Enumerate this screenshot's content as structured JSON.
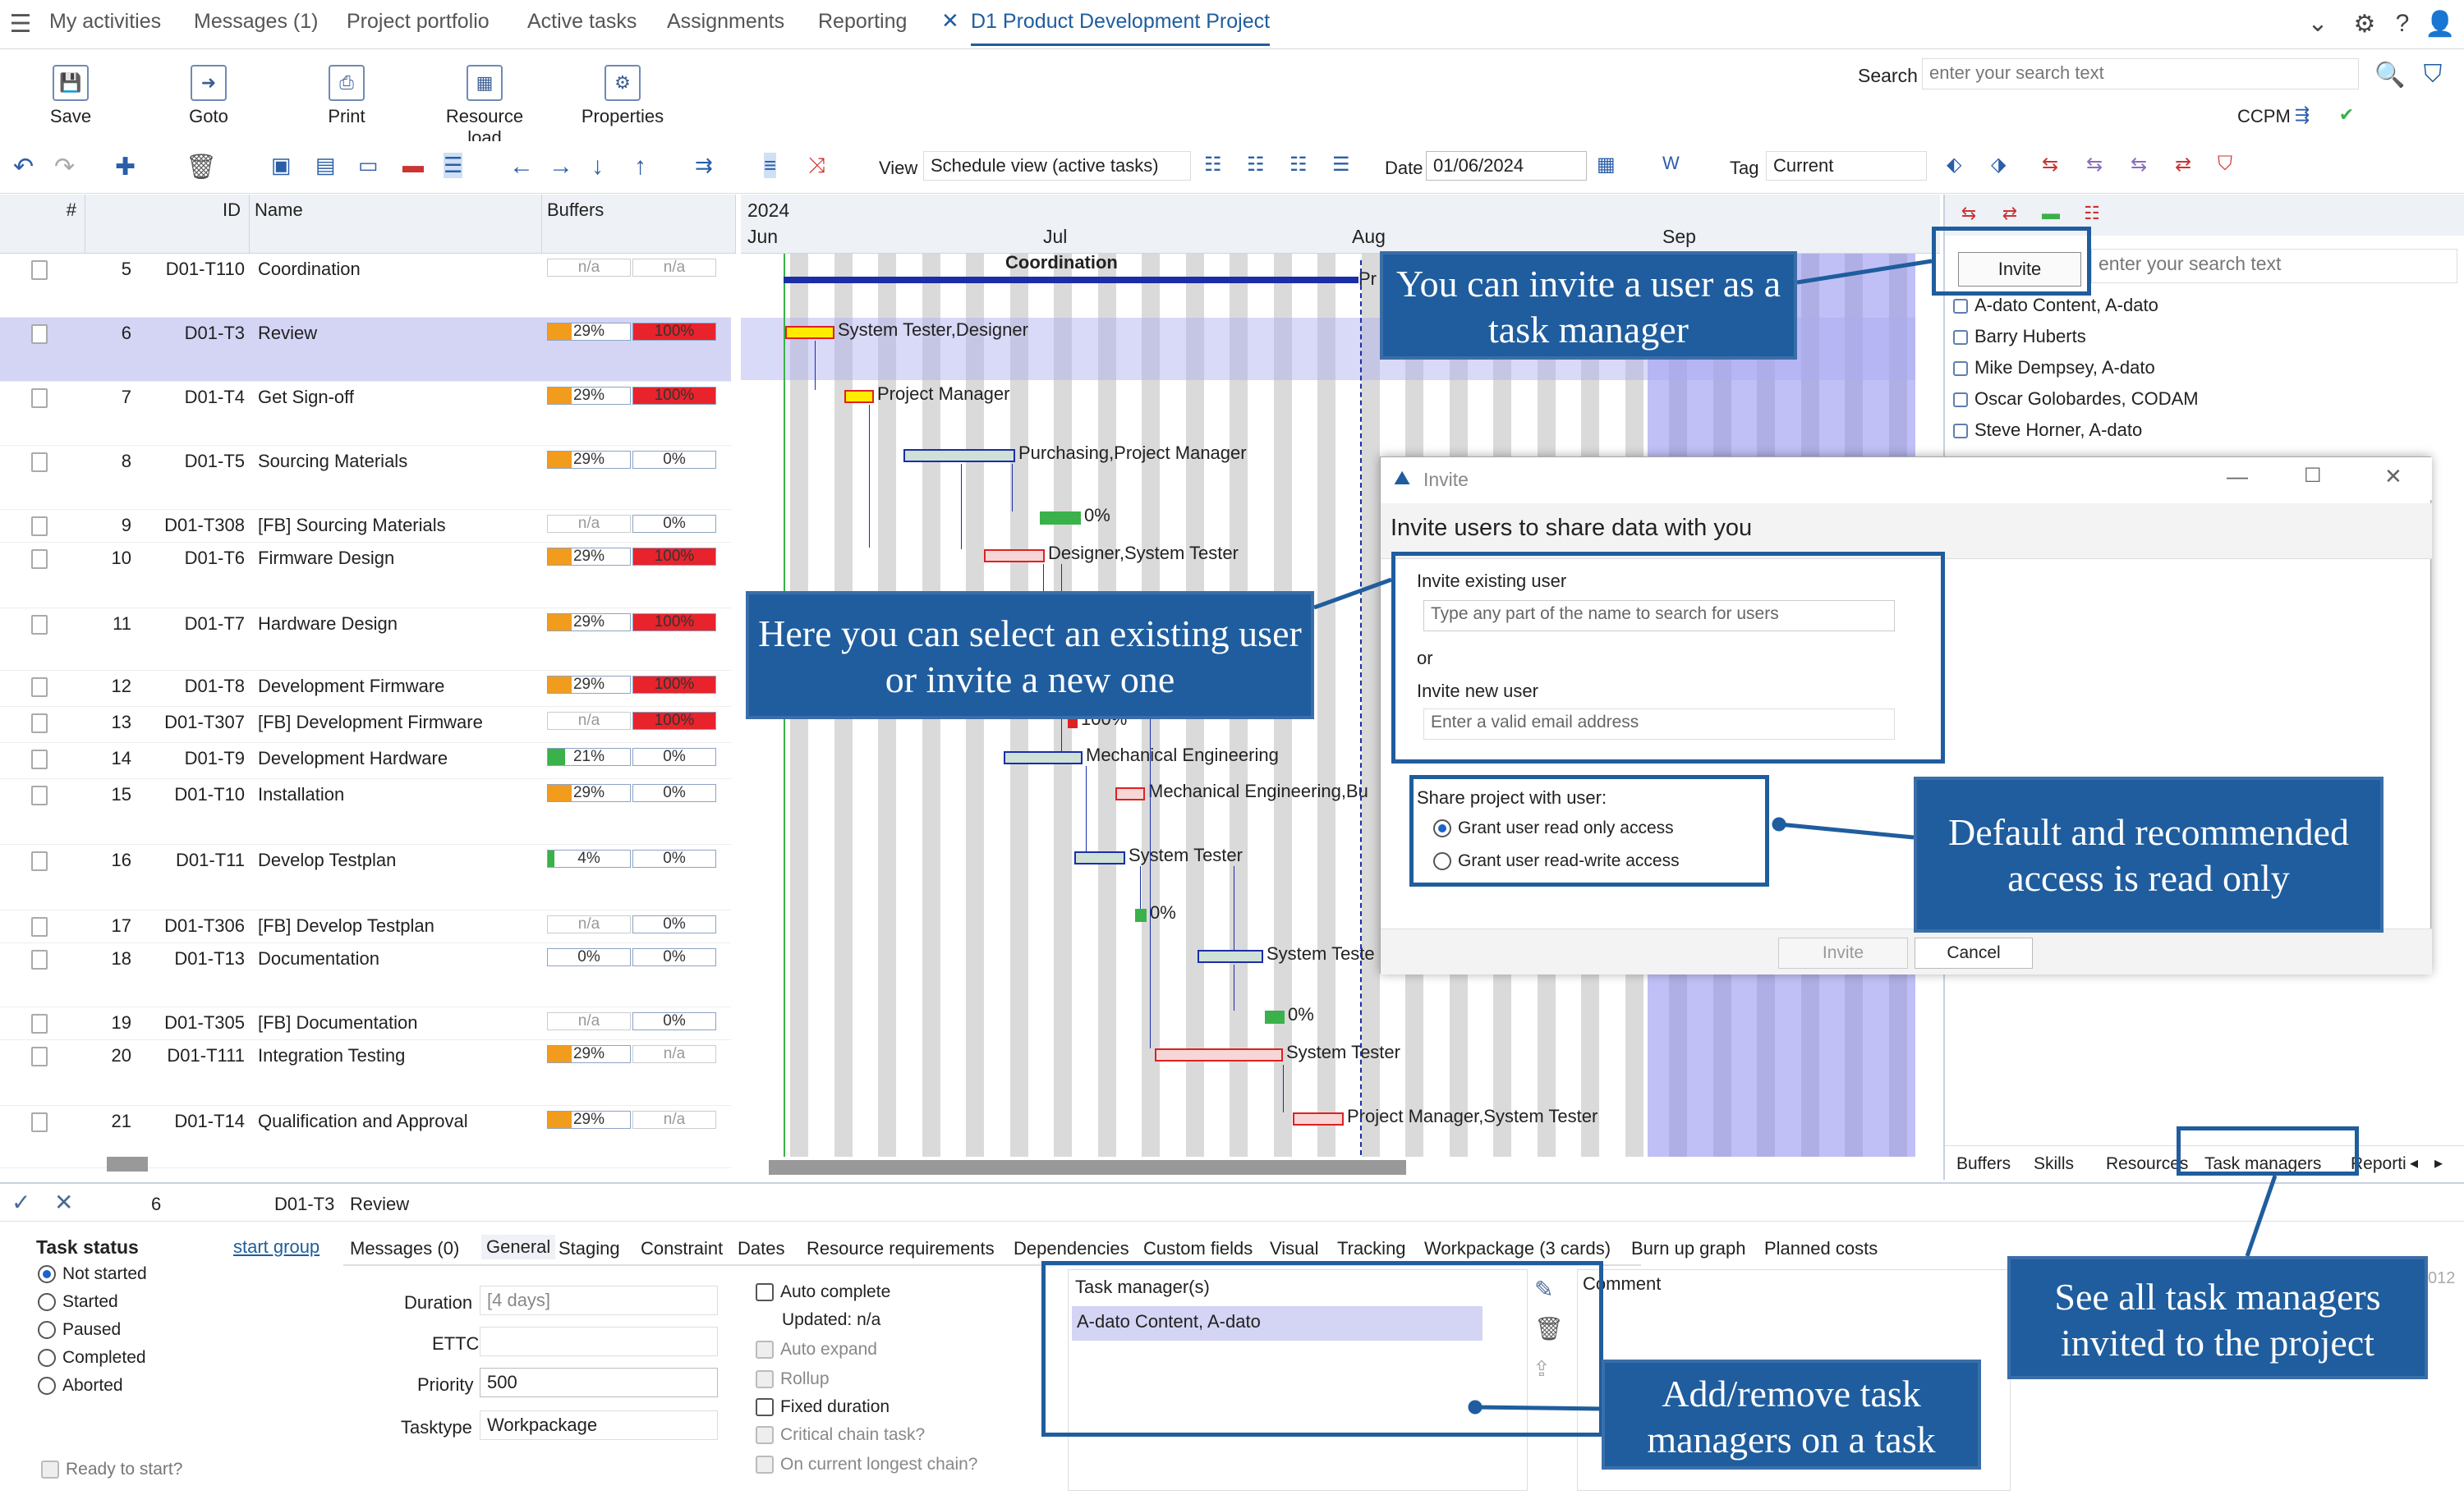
{
  "nav": {
    "tabs": [
      "My activities",
      "Messages (1)",
      "Project portfolio",
      "Active tasks",
      "Assignments",
      "Reporting"
    ],
    "active_tab": "D1 Product Development Project"
  },
  "toolbar": {
    "buttons": [
      "Save",
      "Goto",
      "Print",
      "Resource load",
      "Properties"
    ],
    "search_label": "Search",
    "search_placeholder": "enter your search text",
    "ccpm_label": "CCPM"
  },
  "toolbar2": {
    "view_label": "View",
    "view_value": "Schedule view (active tasks)",
    "date_label": "Date",
    "date_value": "01/06/2024",
    "tag_label": "Tag",
    "tag_value": "Current"
  },
  "grid": {
    "headers": [
      "#",
      "ID",
      "Name",
      "Buffers"
    ],
    "rows": [
      {
        "num": "5",
        "id": "D01-T110",
        "name": "Coordination",
        "b1": "n/a",
        "b2": "n/a"
      },
      {
        "num": "6",
        "id": "D01-T3",
        "name": "Review",
        "b1": "29%",
        "b2": "100%"
      },
      {
        "num": "7",
        "id": "D01-T4",
        "name": "Get Sign-off",
        "b1": "29%",
        "b2": "100%"
      },
      {
        "num": "8",
        "id": "D01-T5",
        "name": "Sourcing Materials",
        "b1": "29%",
        "b2": "0%"
      },
      {
        "num": "9",
        "id": "D01-T308",
        "name": "[FB]  Sourcing Materials",
        "b1": "n/a",
        "b2": "0%"
      },
      {
        "num": "10",
        "id": "D01-T6",
        "name": "Firmware Design",
        "b1": "29%",
        "b2": "100%"
      },
      {
        "num": "11",
        "id": "D01-T7",
        "name": "Hardware Design",
        "b1": "29%",
        "b2": "100%"
      },
      {
        "num": "12",
        "id": "D01-T8",
        "name": "Development Firmware",
        "b1": "29%",
        "b2": "100%"
      },
      {
        "num": "13",
        "id": "D01-T307",
        "name": "[FB]  Development Firmware",
        "b1": "n/a",
        "b2": "100%"
      },
      {
        "num": "14",
        "id": "D01-T9",
        "name": "Development Hardware",
        "b1": "21%",
        "b2": "0%"
      },
      {
        "num": "15",
        "id": "D01-T10",
        "name": "Installation",
        "b1": "29%",
        "b2": "0%"
      },
      {
        "num": "16",
        "id": "D01-T11",
        "name": "Develop Testplan",
        "b1": "4%",
        "b2": "0%"
      },
      {
        "num": "17",
        "id": "D01-T306",
        "name": "[FB]  Develop Testplan",
        "b1": "n/a",
        "b2": "0%"
      },
      {
        "num": "18",
        "id": "D01-T13",
        "name": "Documentation",
        "b1": "0%",
        "b2": "0%"
      },
      {
        "num": "19",
        "id": "D01-T305",
        "name": "[FB]  Documentation",
        "b1": "n/a",
        "b2": "0%"
      },
      {
        "num": "20",
        "id": "D01-T111",
        "name": "Integration Testing",
        "b1": "29%",
        "b2": "n/a"
      },
      {
        "num": "21",
        "id": "D01-T14",
        "name": "Qualification and Approval",
        "b1": "29%",
        "b2": "n/a"
      }
    ]
  },
  "gantt": {
    "year": "2024",
    "months": [
      "Jun",
      "Jul",
      "Aug",
      "Sep"
    ],
    "summary_label": "Coordination",
    "pr_label": "Pr",
    "labels": [
      "System Tester,Designer",
      "Project Manager",
      "Purchasing,Project Manager",
      "0%",
      "Designer,System Tester",
      "100%",
      "Mechanical Engineering",
      "Mechanical Engineering,Bu",
      "System Tester",
      "0%",
      "System Teste",
      "0%",
      "System Tester",
      "Project Manager,System Tester"
    ]
  },
  "right_panel": {
    "invite_button": "Invite",
    "search_placeholder": "enter your search text",
    "users": [
      "A-dato Content, A-dato",
      "Barry Huberts",
      "Mike Dempsey, A-dato",
      "Oscar Golobardes, CODAM",
      "Steve Horner, A-dato"
    ],
    "tabs": [
      "Buffers",
      "Skills",
      "Resources",
      "Task managers",
      "Reporti"
    ]
  },
  "dialog": {
    "title": "Invite",
    "heading": "Invite users to share data with you",
    "existing_label": "Invite existing user",
    "existing_placeholder": "Type any part of the name to search for users",
    "or": "or",
    "new_label": "Invite new user",
    "new_placeholder": "Enter a valid email address",
    "share_label": "Share project with user:",
    "opt_read": "Grant user read only access",
    "opt_rw": "Grant user read-write access",
    "invite_btn": "Invite",
    "cancel_btn": "Cancel"
  },
  "bottom": {
    "num": "6",
    "id": "D01-T3",
    "name": "Review",
    "status_title": "Task status",
    "start_group": "start group",
    "statuses": [
      "Not started",
      "Started",
      "Paused",
      "Completed",
      "Aborted"
    ],
    "ready": "Ready to start?",
    "tabs": [
      "Messages (0)",
      "General",
      "Staging",
      "Constraint",
      "Dates",
      "Resource requirements",
      "Dependencies",
      "Custom fields",
      "Visual",
      "Tracking",
      "Workpackage (3 cards)",
      "Burn up graph",
      "Planned costs"
    ],
    "duration_label": "Duration",
    "duration_value": "[4 days]",
    "ettc_label": "ETTC",
    "priority_label": "Priority",
    "priority_value": "500",
    "tasktype_label": "Tasktype",
    "tasktype_value": "Workpackage",
    "checks": [
      "Auto complete",
      "Updated: n/a",
      "Auto expand",
      "Rollup",
      "Fixed duration",
      "Critical chain task?",
      "On current longest chain?"
    ],
    "tm_header": "Task manager(s)",
    "tm_value": "A-dato Content, A-dato",
    "comment_label": "Comment",
    "side_num": "012"
  },
  "callouts": {
    "c1": "You can invite a user as a task manager",
    "c2": "Here you can select an existing user or invite a new one",
    "c3": "Default and recommended access is read only",
    "c4": "See all task managers invited to the project",
    "c5": "Add/remove task managers on a task"
  },
  "colors": {
    "accent": "#1f5d9e",
    "buffer_red": "#e8232b",
    "buffer_green": "#3ab14a",
    "buffer_orange": "#f29c1e"
  }
}
